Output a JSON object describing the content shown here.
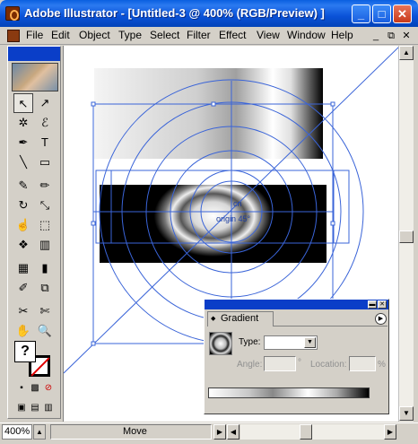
{
  "window": {
    "title": "Adobe Illustrator - [Untitled-3 @ 400% (RGB/Preview) ]",
    "minimize": "_",
    "maximize": "□",
    "close": "✕"
  },
  "menu": {
    "items": [
      "File",
      "Edit",
      "Object",
      "Type",
      "Select",
      "Filter",
      "Effect",
      "View",
      "Window",
      "Help"
    ],
    "mdi_min": "_",
    "mdi_restore": "⧉",
    "mdi_close": "✕"
  },
  "tools": [
    {
      "name": "selection-tool-icon",
      "glyph": "↖"
    },
    {
      "name": "direct-selection-tool-icon",
      "glyph": "↗"
    },
    {
      "name": "magic-wand-tool-icon",
      "glyph": "✲"
    },
    {
      "name": "lasso-tool-icon",
      "glyph": "ℰ"
    },
    {
      "name": "pen-tool-icon",
      "glyph": "✒"
    },
    {
      "name": "type-tool-icon",
      "glyph": "T"
    },
    {
      "name": "line-tool-icon",
      "glyph": "╲"
    },
    {
      "name": "rectangle-tool-icon",
      "glyph": "▭"
    },
    {
      "name": "paintbrush-tool-icon",
      "glyph": "✎"
    },
    {
      "name": "pencil-tool-icon",
      "glyph": "✏"
    },
    {
      "name": "rotate-tool-icon",
      "glyph": "↻"
    },
    {
      "name": "scale-tool-icon",
      "glyph": "⤡"
    },
    {
      "name": "warp-tool-icon",
      "glyph": "☝"
    },
    {
      "name": "free-transform-tool-icon",
      "glyph": "⬚"
    },
    {
      "name": "symbol-sprayer-tool-icon",
      "glyph": "❖"
    },
    {
      "name": "graph-tool-icon",
      "glyph": "▥"
    },
    {
      "name": "mesh-tool-icon",
      "glyph": "▦"
    },
    {
      "name": "gradient-tool-icon",
      "glyph": "▮"
    },
    {
      "name": "eyedropper-tool-icon",
      "glyph": "✐"
    },
    {
      "name": "blend-tool-icon",
      "glyph": "⧉"
    },
    {
      "name": "slice-tool-icon",
      "glyph": "✂"
    },
    {
      "name": "scissors-tool-icon",
      "glyph": "✄"
    },
    {
      "name": "hand-tool-icon",
      "glyph": "✋"
    },
    {
      "name": "zoom-tool-icon",
      "glyph": "🔍"
    }
  ],
  "fill_stroke": {
    "fill_glyph": "?"
  },
  "canvas": {
    "center_label": "cn",
    "origin_label": "origin 45°"
  },
  "status": {
    "zoom": "400%",
    "tool": "Move"
  },
  "gradient_palette": {
    "tab": "Gradient",
    "type_label": "Type:",
    "type_value": "",
    "angle_label": "Angle:",
    "angle_value": "",
    "angle_unit": "°",
    "location_label": "Location:",
    "location_value": "",
    "location_unit": "%"
  }
}
